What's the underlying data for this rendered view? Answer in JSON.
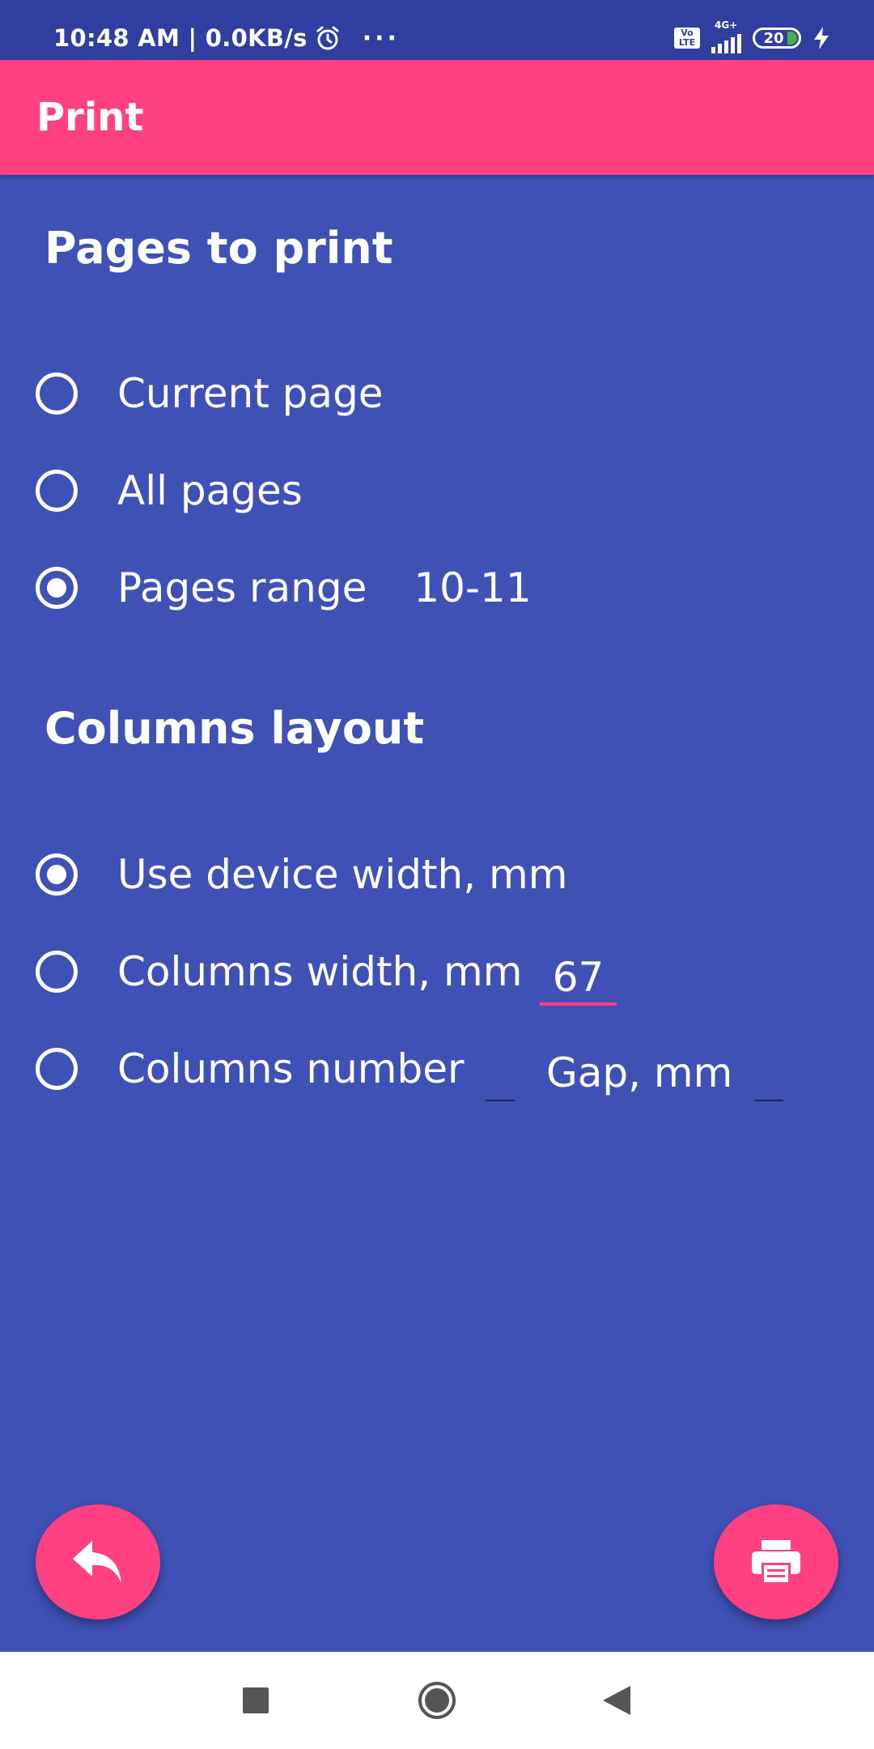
{
  "status_bar": {
    "time_speed": "10:48 AM | 0.0KB/s",
    "more": "···",
    "volte_line1": "Vo",
    "volte_line2": "LTE",
    "network": "4G+",
    "battery_level": "20"
  },
  "app_bar": {
    "title": "Print"
  },
  "pages_section": {
    "title": "Pages to print",
    "options": [
      {
        "label": "Current page",
        "checked": false
      },
      {
        "label": "All pages",
        "checked": false
      },
      {
        "label": "Pages range",
        "checked": true
      }
    ],
    "range_value": "10-11"
  },
  "columns_section": {
    "title": "Columns layout",
    "options": [
      {
        "label": "Use device width, mm",
        "checked": true
      },
      {
        "label": "Columns width, mm",
        "checked": false
      },
      {
        "label": "Columns number",
        "checked": false
      }
    ],
    "columns_width_value": "67",
    "columns_number_value": "",
    "gap_label": "Gap, mm",
    "gap_value": ""
  },
  "fabs": {
    "back_icon": "reply-icon",
    "print_icon": "print-icon"
  },
  "nav_bar": {
    "recents_icon": "square-icon",
    "home_icon": "circle-icon",
    "back_icon": "triangle-back-icon"
  },
  "colors": {
    "background": "#3F51B5",
    "status_bar": "#303F9F",
    "accent": "#FF4081"
  }
}
